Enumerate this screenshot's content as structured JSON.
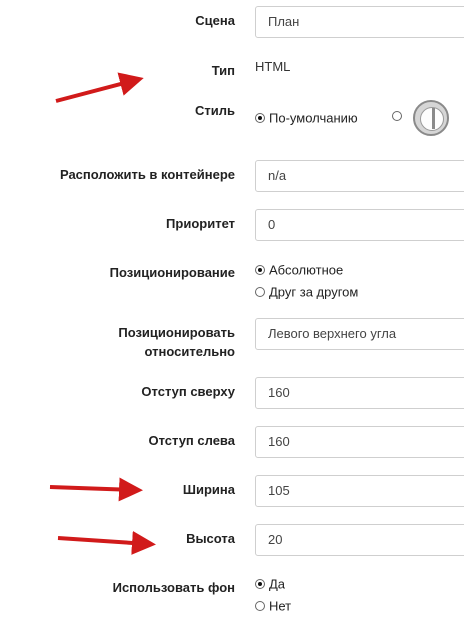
{
  "form": {
    "scene": {
      "label": "Сцена",
      "value": "План"
    },
    "type": {
      "label": "Тип",
      "value": "HTML"
    },
    "style": {
      "label": "Стиль",
      "option_default": "По-умолчанию"
    },
    "container": {
      "label": "Расположить в контейнере",
      "value": "n/a"
    },
    "priority": {
      "label": "Приоритет",
      "value": "0"
    },
    "positioning": {
      "label": "Позиционирование",
      "option_absolute": "Абсолютное",
      "option_sequential": "Друг за другом",
      "selected": "Абсолютное"
    },
    "position_relative": {
      "label_line1": "Позиционировать",
      "label_line2": "относительно",
      "value": "Левого верхнего угла"
    },
    "top_offset": {
      "label": "Отступ сверху",
      "value": "160"
    },
    "left_offset": {
      "label": "Отступ слева",
      "value": "160"
    },
    "width": {
      "label": "Ширина",
      "value": "105"
    },
    "height": {
      "label": "Высота",
      "value": "20"
    },
    "use_background": {
      "label": "Использовать фон",
      "option_yes": "Да",
      "option_no": "Нет",
      "selected": "Да"
    }
  },
  "colors": {
    "arrow": "#d11a1a",
    "input_border": "#cfcfcf"
  }
}
